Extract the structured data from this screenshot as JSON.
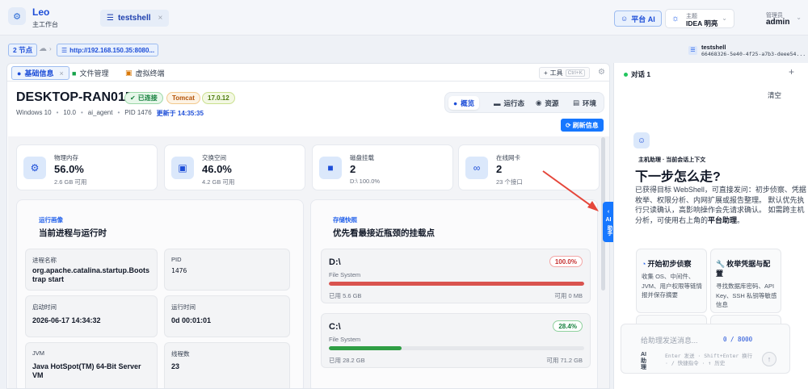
{
  "brand": {
    "name": "Leo",
    "subtitle": "主工作台"
  },
  "header": {
    "session_tab": "testshell",
    "ai_button": "平台 AI",
    "theme_label": "主题",
    "theme_value": "IDEA 明亮",
    "user_label": "管理员",
    "user_value": "admin"
  },
  "nodebar": {
    "nodes": "2 节点",
    "url": "http://192.168.150.35:8080...",
    "session_name": "testshell",
    "session_id": "66468326-5e40-4f25-a7b3-deee54..."
  },
  "tabs": {
    "basic": "基础信息",
    "files": "文件管理",
    "terminal": "虚拟终端",
    "tools": "工具",
    "tools_kbd": "Ctrl+K"
  },
  "host": {
    "name": "DESKTOP-RAN01R2",
    "status": "已连接",
    "server": "Tomcat",
    "version": "17.0.12",
    "os": "Windows 10",
    "os_version": "10.0",
    "agent": "ai_agent",
    "pid": "PID 1476",
    "updated": "更新于 14:35:35"
  },
  "view_tabs": {
    "overview": "概览",
    "runtime": "运行态",
    "resources": "资源",
    "env": "环境"
  },
  "refresh_button": "刷新信息",
  "stats": [
    {
      "label": "物理内存",
      "value": "56.0%",
      "sub": "2.6 GB 可用",
      "icon": "memory-icon"
    },
    {
      "label": "交换空间",
      "value": "46.0%",
      "sub": "4.2 GB 可用",
      "icon": "swap-icon"
    },
    {
      "label": "磁盘挂载",
      "value": "2",
      "sub": "D:\\ 100.0%",
      "icon": "folder-icon"
    },
    {
      "label": "在线网卡",
      "value": "2",
      "sub": "23 个接口",
      "icon": "link-icon"
    }
  ],
  "runtime_panel": {
    "kicker": "运行画像",
    "title": "当前进程与运行时",
    "items": [
      {
        "k": "进程名称",
        "v": "org.apache.catalina.startup.Bootstrap start"
      },
      {
        "k": "PID",
        "v": "1476"
      },
      {
        "k": "启动时间",
        "v": "2026-06-17 14:34:32"
      },
      {
        "k": "运行时间",
        "v": "0d 00:01:01"
      },
      {
        "k": "JVM",
        "v": "Java HotSpot(TM) 64-Bit Server VM"
      },
      {
        "k": "线程数",
        "v": "23"
      }
    ]
  },
  "storage_panel": {
    "kicker": "存储快照",
    "title": "优先看最接近瓶颈的挂载点",
    "disks": [
      {
        "name": "D:\\",
        "fs": "File System",
        "pct": "100.0%",
        "pct_value": 100.0,
        "used": "已用 5.6 GB",
        "avail": "可用 0 MB",
        "color": "#d9534f"
      },
      {
        "name": "C:\\",
        "fs": "File System",
        "pct": "28.4%",
        "pct_value": 28.4,
        "used": "已用 28.2 GB",
        "avail": "可用 71.2 GB",
        "color": "#2f9e44"
      }
    ]
  },
  "side_tab": {
    "label1": "AI",
    "label2": "助手"
  },
  "chat": {
    "tab": "对话 1",
    "clear": "清空",
    "kicker": "主机助理 · 当前会话上下文",
    "title": "下一步怎么走?",
    "desc_prefix": "已获得目标 WebShell，可直接发问：初步侦察、凭据枚举、权限分析、内网扩展或报告整理。 默认优先执行只读确认，高影响操作会先请求确认。 如需跨主机分析，可使用右上角的",
    "desc_bold": "平台助理",
    "desc_suffix": "。",
    "cards": [
      {
        "title": "开始初步侦察",
        "desc": "收集 OS、中间件、JVM、用户权限等链情报并保存摘要",
        "icon": "radar-icon"
      },
      {
        "title": "枚举凭据与配置",
        "desc": "寻找数据库密码、API Key、SSH 私钥等敏感信息",
        "icon": "wrench-icon"
      }
    ],
    "input_placeholder": "给助理发送消息...",
    "counter": "0 / 8000",
    "mode_line1": "AI",
    "mode_line2": "助",
    "mode_line3": "理",
    "hint": "Enter 发送 · Shift+Enter 换行 · / 快捷指令 · ↑ 历史"
  },
  "colors": {
    "accent": "#1677ff",
    "brand": "#1d4ed8",
    "danger": "#d9534f",
    "success": "#2f9e44"
  }
}
